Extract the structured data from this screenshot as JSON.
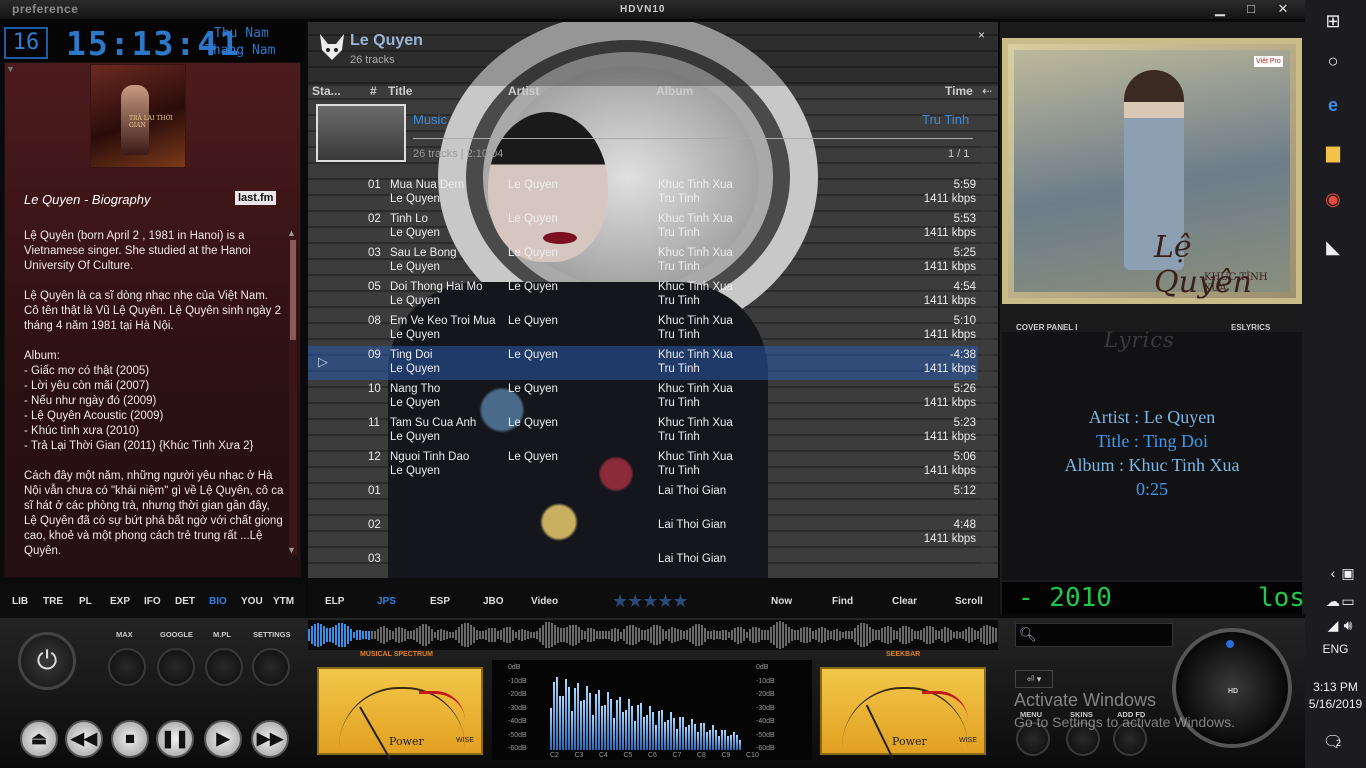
{
  "titlebar": {
    "brand": "preference",
    "title": "HDVN10",
    "min": "▁",
    "max": "□",
    "close": "✕"
  },
  "clock": {
    "day": "16",
    "time": "15:13:41",
    "dayname": "Thu Nam",
    "monthname": "Thang Nam"
  },
  "bio": {
    "heading": "Le Quyen - Biography",
    "source": "last.fm",
    "album_art_text": "TRẢ LẠI THỜI GIAN",
    "text": "Lệ Quyên (born April 2 , 1981 in Hanoi) is a Vietnamese singer. She studied at the Hanoi University Of Culture.\n\nLệ Quyên là ca sĩ dòng nhạc nhẹ của Việt Nam. Cô tên thật là Vũ Lệ Quyên. Lệ Quyên sinh ngày 2 tháng 4 năm 1981 tại Hà Nội.\n\nAlbum:\n- Giấc mơ có thật (2005)\n- Lời yêu còn mãi (2007)\n- Nếu như ngày đó (2009)\n- Lệ Quyên Acoustic (2009)\n- Khúc tình xưa (2010)\n- Trả Lại Thời Gian (2011) {Khúc Tình Xưa 2}\n\nCách đây một năm, những người yêu nhạc ở Hà Nội vẫn chưa có \"khái niệm\" gì về Lệ Quyên, cô ca sĩ hát ở các phòng trà, nhưng thời gian gần đây, Lệ Quyên đã có sự bứt phá bất ngờ với chất giọng cao, khoẻ và một phong cách trẻ trung rất ...Lệ Quyên."
  },
  "left_tabs": [
    "LIB",
    "TRE",
    "PL",
    "EXP",
    "IFO",
    "DET",
    "BIO",
    "YOU",
    "YTM"
  ],
  "left_tab_active": "BIO",
  "playlist": {
    "artist": "Le Quyen",
    "track_count": "26 tracks",
    "close": "×",
    "columns": [
      "Sta...",
      "#",
      "Title",
      "Artist",
      "Album",
      "Time"
    ],
    "group_genre": "Music",
    "group_genre2": "Tru Tinh",
    "group_info": "26 tracks | 2:10:04",
    "group_page": "1 / 1",
    "rows": [
      {
        "num": "01",
        "title": "Mua Nua Dem",
        "artist": "Le Quyen",
        "sub_artist": "Le Quyen",
        "album": "Khuc Tinh Xua",
        "genre": "Tru Tinh",
        "time": "5:59",
        "kbps": "1411 kbps"
      },
      {
        "num": "02",
        "title": "Tinh Lo",
        "artist": "Le Quyen",
        "sub_artist": "Le Quyen",
        "album": "Khuc Tinh Xua",
        "genre": "Tru Tinh",
        "time": "5:53",
        "kbps": "1411 kbps"
      },
      {
        "num": "03",
        "title": "Sau Le Bong",
        "artist": "Le Quyen",
        "sub_artist": "Le Quyen",
        "album": "Khuc Tinh Xua",
        "genre": "Tru Tinh",
        "time": "5:25",
        "kbps": "1411 kbps"
      },
      {
        "num": "05",
        "title": "Doi Thong Hai Mo",
        "artist": "Le Quyen",
        "sub_artist": "Le Quyen",
        "album": "Khuc Tinh Xua",
        "genre": "Tru Tinh",
        "time": "4:54",
        "kbps": "1411 kbps"
      },
      {
        "num": "08",
        "title": "Em Ve Keo Troi Mua",
        "artist": "Le Quyen",
        "sub_artist": "Le Quyen",
        "album": "Khuc Tinh Xua",
        "genre": "Tru Tinh",
        "time": "5:10",
        "kbps": "1411 kbps"
      },
      {
        "num": "09",
        "title": "Ting Doi",
        "artist": "Le Quyen",
        "sub_artist": "Le Quyen",
        "album": "Khuc Tinh Xua",
        "genre": "Tru Tinh",
        "time": "-4:38",
        "kbps": "1411 kbps"
      },
      {
        "num": "10",
        "title": "Nang Tho",
        "artist": "Le Quyen",
        "sub_artist": "Le Quyen",
        "album": "Khuc Tinh Xua",
        "genre": "Tru Tinh",
        "time": "5:26",
        "kbps": "1411 kbps"
      },
      {
        "num": "11",
        "title": "Tam Su Cua Anh",
        "artist": "Le Quyen",
        "sub_artist": "Le Quyen",
        "album": "Khuc Tinh Xua",
        "genre": "Tru Tinh",
        "time": "5:23",
        "kbps": "1411 kbps"
      },
      {
        "num": "12",
        "title": "Nguoi Tinh Dao",
        "artist": "Le Quyen",
        "sub_artist": "Le Quyen",
        "album": "Khuc Tinh Xua",
        "genre": "Tru Tinh",
        "time": "5:06",
        "kbps": "1411 kbps"
      },
      {
        "num": "01",
        "title": "",
        "artist": "",
        "sub_artist": "",
        "album": "Lai Thoi Gian",
        "genre": "",
        "time": "5:12",
        "kbps": ""
      },
      {
        "num": "02",
        "title": "",
        "artist": "",
        "sub_artist": "",
        "album": "Lai Thoi Gian",
        "genre": "",
        "time": "4:48",
        "kbps": "1411 kbps"
      },
      {
        "num": "03",
        "title": "",
        "artist": "",
        "sub_artist": "",
        "album": "Lai Thoi Gian",
        "genre": "",
        "time": "",
        "kbps": ""
      }
    ],
    "selected_index": 5
  },
  "playlist_tabs": [
    "ELP",
    "JPS",
    "ESP",
    "JBO",
    "Video"
  ],
  "playlist_tab_active": "JPS",
  "rating": "★★★★★",
  "playlist_actions": [
    "Now",
    "Find",
    "Clear",
    "Scroll"
  ],
  "right": {
    "cover_title": "Lệ Quyên",
    "cover_sub": "KHÚC TÌNH XƯA",
    "cover_badge": "Việt Pro",
    "cover_label": "COVER PANEL I",
    "es_label": "ESLYRICS",
    "lyrics_title": "Lyrics",
    "artist_line": "Artist : Le Quyen",
    "title_line": "Title : Ting Doi",
    "album_line": "Album : Khuc Tinh Xua",
    "time_line": "0:25",
    "year": "- 2010",
    "lossless": "los"
  },
  "deck": {
    "knob_labels": [
      "MAX",
      "GOOGLE",
      "M.PL",
      "SETTINGS"
    ],
    "transport": [
      "⏏",
      "◀◀",
      "■",
      "❚❚",
      "▶",
      "▶▶"
    ],
    "musical_spectrum": "MUSICAL SPECTRUM",
    "seekbar": "SEEKBAR",
    "vu_power": "Power",
    "vu_wise": "WISE",
    "db_labels": [
      "0dB",
      "-10dB",
      "-20dB",
      "-30dB",
      "-40dB",
      "-50dB",
      "-60dB"
    ],
    "freq_labels": [
      "C2",
      "C3",
      "C4",
      "C5",
      "C6",
      "C7",
      "C8",
      "C9",
      "C10"
    ],
    "right_labels": [
      "MENU",
      "SKINS",
      "ADD FD"
    ],
    "hd": "HD",
    "activate_1": "Activate Windows",
    "activate_2": "Go to Settings to activate Windows."
  },
  "taskbar": {
    "lang": "ENG",
    "time": "3:13 PM",
    "date": "5/16/2019",
    "notif": "2"
  }
}
